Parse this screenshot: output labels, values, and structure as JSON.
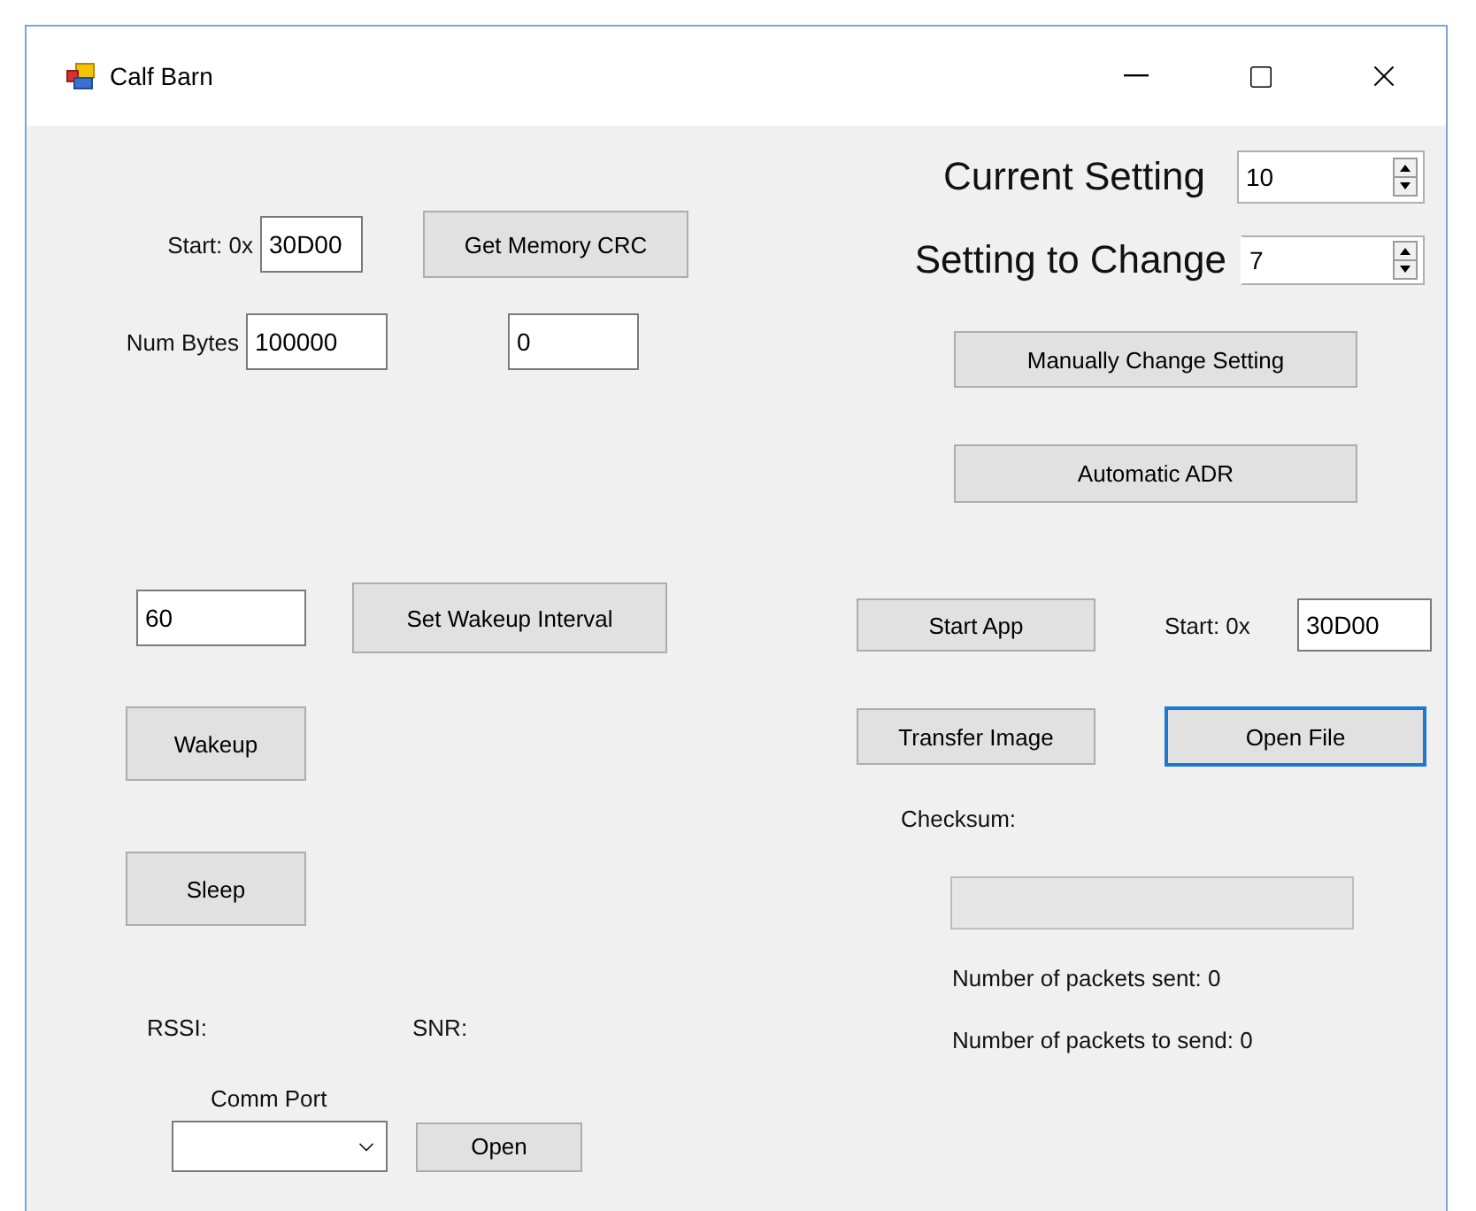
{
  "window": {
    "title": "Calf Barn"
  },
  "memory": {
    "start_label": "Start: 0x",
    "start_value": "30D00",
    "crc_button": "Get Memory CRC",
    "num_bytes_label": "Num Bytes",
    "num_bytes_value": "100000",
    "crc_result": "0"
  },
  "wakeup": {
    "interval_value": "60",
    "set_button": "Set Wakeup Interval",
    "wakeup_button": "Wakeup",
    "sleep_button": "Sleep"
  },
  "signal": {
    "rssi_label": "RSSI:",
    "snr_label": "SNR:"
  },
  "comm": {
    "label": "Comm Port",
    "open_button": "Open"
  },
  "settings": {
    "current_label": "Current Setting",
    "current_value": "10",
    "change_label": "Setting to Change",
    "change_value": "7",
    "manual_button": "Manually Change Setting",
    "auto_button": "Automatic ADR"
  },
  "app": {
    "start_app_button": "Start App",
    "start_label": "Start: 0x",
    "start_value": "30D00",
    "transfer_button": "Transfer Image",
    "open_file_button": {
      "label": "Open File",
      "focused": true
    },
    "checksum_label": "Checksum:",
    "packets_sent": "Number of packets sent: 0",
    "packets_to_send": "Number of packets to send: 0"
  }
}
